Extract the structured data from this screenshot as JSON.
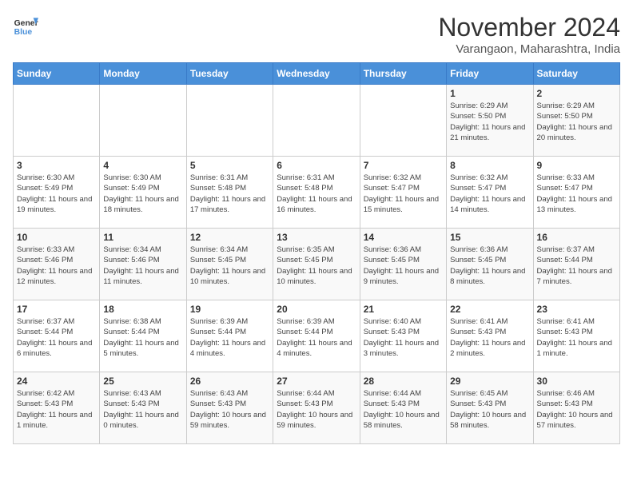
{
  "header": {
    "logo_general": "General",
    "logo_blue": "Blue",
    "month": "November 2024",
    "location": "Varangaon, Maharashtra, India"
  },
  "weekdays": [
    "Sunday",
    "Monday",
    "Tuesday",
    "Wednesday",
    "Thursday",
    "Friday",
    "Saturday"
  ],
  "weeks": [
    [
      {
        "day": "",
        "info": ""
      },
      {
        "day": "",
        "info": ""
      },
      {
        "day": "",
        "info": ""
      },
      {
        "day": "",
        "info": ""
      },
      {
        "day": "",
        "info": ""
      },
      {
        "day": "1",
        "info": "Sunrise: 6:29 AM\nSunset: 5:50 PM\nDaylight: 11 hours and 21 minutes."
      },
      {
        "day": "2",
        "info": "Sunrise: 6:29 AM\nSunset: 5:50 PM\nDaylight: 11 hours and 20 minutes."
      }
    ],
    [
      {
        "day": "3",
        "info": "Sunrise: 6:30 AM\nSunset: 5:49 PM\nDaylight: 11 hours and 19 minutes."
      },
      {
        "day": "4",
        "info": "Sunrise: 6:30 AM\nSunset: 5:49 PM\nDaylight: 11 hours and 18 minutes."
      },
      {
        "day": "5",
        "info": "Sunrise: 6:31 AM\nSunset: 5:48 PM\nDaylight: 11 hours and 17 minutes."
      },
      {
        "day": "6",
        "info": "Sunrise: 6:31 AM\nSunset: 5:48 PM\nDaylight: 11 hours and 16 minutes."
      },
      {
        "day": "7",
        "info": "Sunrise: 6:32 AM\nSunset: 5:47 PM\nDaylight: 11 hours and 15 minutes."
      },
      {
        "day": "8",
        "info": "Sunrise: 6:32 AM\nSunset: 5:47 PM\nDaylight: 11 hours and 14 minutes."
      },
      {
        "day": "9",
        "info": "Sunrise: 6:33 AM\nSunset: 5:47 PM\nDaylight: 11 hours and 13 minutes."
      }
    ],
    [
      {
        "day": "10",
        "info": "Sunrise: 6:33 AM\nSunset: 5:46 PM\nDaylight: 11 hours and 12 minutes."
      },
      {
        "day": "11",
        "info": "Sunrise: 6:34 AM\nSunset: 5:46 PM\nDaylight: 11 hours and 11 minutes."
      },
      {
        "day": "12",
        "info": "Sunrise: 6:34 AM\nSunset: 5:45 PM\nDaylight: 11 hours and 10 minutes."
      },
      {
        "day": "13",
        "info": "Sunrise: 6:35 AM\nSunset: 5:45 PM\nDaylight: 11 hours and 10 minutes."
      },
      {
        "day": "14",
        "info": "Sunrise: 6:36 AM\nSunset: 5:45 PM\nDaylight: 11 hours and 9 minutes."
      },
      {
        "day": "15",
        "info": "Sunrise: 6:36 AM\nSunset: 5:45 PM\nDaylight: 11 hours and 8 minutes."
      },
      {
        "day": "16",
        "info": "Sunrise: 6:37 AM\nSunset: 5:44 PM\nDaylight: 11 hours and 7 minutes."
      }
    ],
    [
      {
        "day": "17",
        "info": "Sunrise: 6:37 AM\nSunset: 5:44 PM\nDaylight: 11 hours and 6 minutes."
      },
      {
        "day": "18",
        "info": "Sunrise: 6:38 AM\nSunset: 5:44 PM\nDaylight: 11 hours and 5 minutes."
      },
      {
        "day": "19",
        "info": "Sunrise: 6:39 AM\nSunset: 5:44 PM\nDaylight: 11 hours and 4 minutes."
      },
      {
        "day": "20",
        "info": "Sunrise: 6:39 AM\nSunset: 5:44 PM\nDaylight: 11 hours and 4 minutes."
      },
      {
        "day": "21",
        "info": "Sunrise: 6:40 AM\nSunset: 5:43 PM\nDaylight: 11 hours and 3 minutes."
      },
      {
        "day": "22",
        "info": "Sunrise: 6:41 AM\nSunset: 5:43 PM\nDaylight: 11 hours and 2 minutes."
      },
      {
        "day": "23",
        "info": "Sunrise: 6:41 AM\nSunset: 5:43 PM\nDaylight: 11 hours and 1 minute."
      }
    ],
    [
      {
        "day": "24",
        "info": "Sunrise: 6:42 AM\nSunset: 5:43 PM\nDaylight: 11 hours and 1 minute."
      },
      {
        "day": "25",
        "info": "Sunrise: 6:43 AM\nSunset: 5:43 PM\nDaylight: 11 hours and 0 minutes."
      },
      {
        "day": "26",
        "info": "Sunrise: 6:43 AM\nSunset: 5:43 PM\nDaylight: 10 hours and 59 minutes."
      },
      {
        "day": "27",
        "info": "Sunrise: 6:44 AM\nSunset: 5:43 PM\nDaylight: 10 hours and 59 minutes."
      },
      {
        "day": "28",
        "info": "Sunrise: 6:44 AM\nSunset: 5:43 PM\nDaylight: 10 hours and 58 minutes."
      },
      {
        "day": "29",
        "info": "Sunrise: 6:45 AM\nSunset: 5:43 PM\nDaylight: 10 hours and 58 minutes."
      },
      {
        "day": "30",
        "info": "Sunrise: 6:46 AM\nSunset: 5:43 PM\nDaylight: 10 hours and 57 minutes."
      }
    ]
  ]
}
